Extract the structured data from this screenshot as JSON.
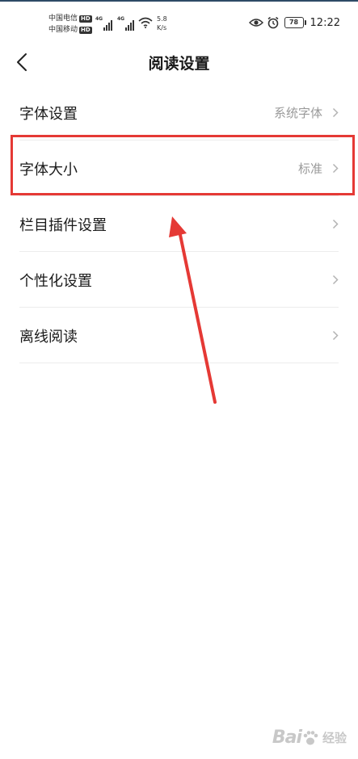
{
  "status_bar": {
    "carrier_1": "中国电信",
    "carrier_2": "中国移动",
    "hd_badge": "HD",
    "network_1": "4G",
    "network_2": "4G",
    "speed_value": "5.8",
    "speed_unit": "K/s",
    "battery_level": "78",
    "time": "12:22"
  },
  "header": {
    "title": "阅读设置"
  },
  "settings": {
    "items": [
      {
        "label": "字体设置",
        "value": "系统字体"
      },
      {
        "label": "字体大小",
        "value": "标准"
      },
      {
        "label": "栏目插件设置",
        "value": ""
      },
      {
        "label": "个性化设置",
        "value": ""
      },
      {
        "label": "离线阅读",
        "value": ""
      }
    ]
  },
  "annotation": {
    "highlight_color": "#e53935"
  },
  "watermark": {
    "brand": "Bai",
    "text": "经验"
  }
}
